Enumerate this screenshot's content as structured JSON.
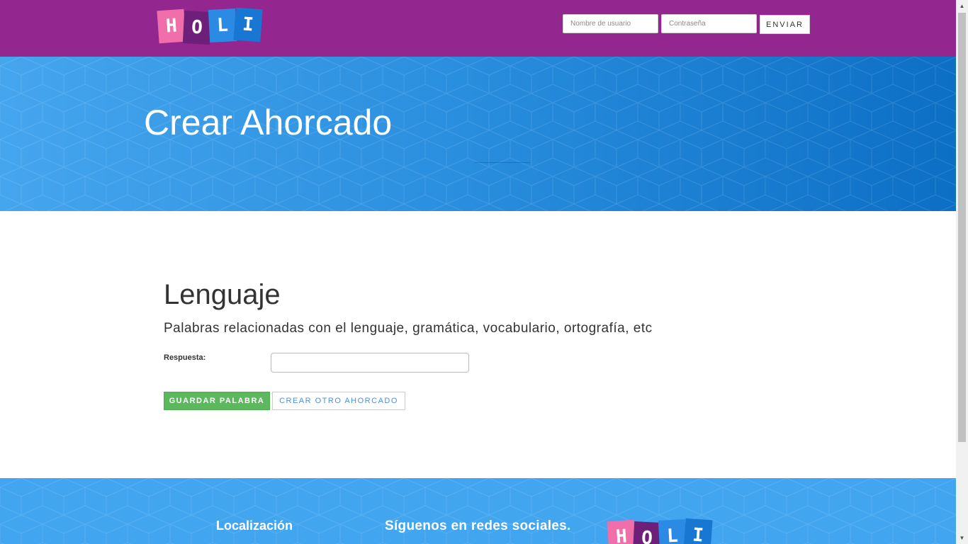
{
  "header": {
    "logo_text": "HOLI",
    "logo_letters": [
      "H",
      "O",
      "L",
      "I"
    ],
    "username_placeholder": "Nombre de usuario",
    "password_placeholder": "Contraseña",
    "submit_label": "ENVIAR"
  },
  "hero": {
    "title": "Crear Ahorcado"
  },
  "category": {
    "title": "Lenguaje",
    "description": "Palabras relacionadas con el lenguaje, gramática, vocabulario, ortografía, etc"
  },
  "form": {
    "answer_label": "Respuesta:",
    "answer_value": "",
    "save_button": "GUARDAR PALABRA",
    "new_button": "CREAR OTRO AHORCADO"
  },
  "footer": {
    "location_heading": "Localización",
    "social_heading": "Síguenos en redes sociales.",
    "logo_letters": [
      "H",
      "O",
      "L",
      "I"
    ]
  },
  "colors": {
    "topbar": "#93278f",
    "hero_start": "#45a6ee",
    "hero_end": "#0c6fc4",
    "save_button": "#5cb85c",
    "footer": "#42a5ef"
  },
  "icons": {
    "scroll_up": "triangle-up-icon",
    "scroll_down": "triangle-down-icon"
  }
}
